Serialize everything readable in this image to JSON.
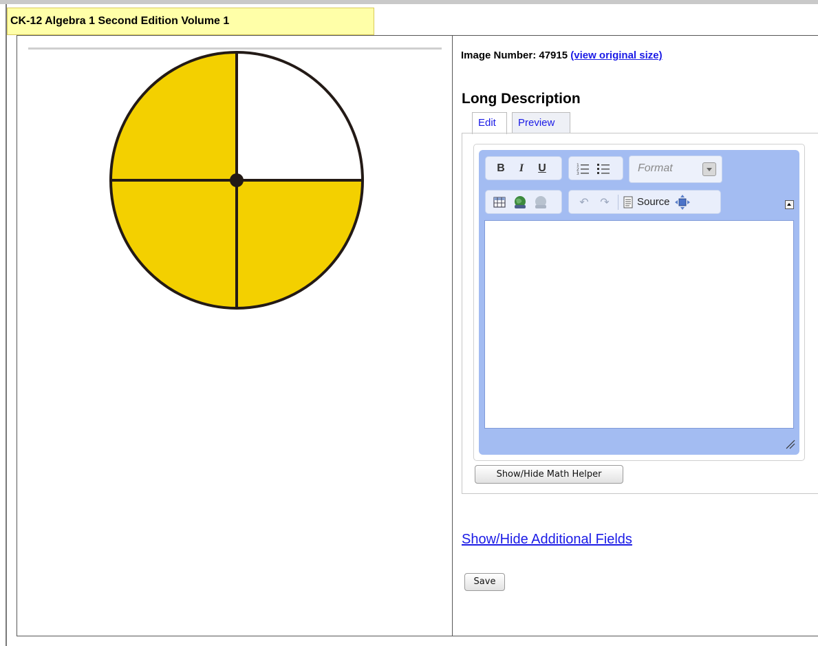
{
  "header": {
    "title": "CK-12 Algebra 1 Second Edition Volume 1"
  },
  "image_info": {
    "label": "Image Number: 47915",
    "view_original_link": "(view original size)"
  },
  "long_description": {
    "heading": "Long Description",
    "tabs": [
      {
        "label": "Edit",
        "active": true
      },
      {
        "label": "Preview",
        "active": false
      }
    ]
  },
  "editor": {
    "toolbar_row1": [
      {
        "name": "bold",
        "label": "B"
      },
      {
        "name": "italic",
        "label": "I"
      },
      {
        "name": "underline",
        "label": "U"
      }
    ],
    "format_placeholder": "Format",
    "source_label": "Source",
    "content": ""
  },
  "buttons": {
    "math_helper": "Show/Hide Math Helper",
    "additional_fields": "Show/Hide Additional Fields",
    "save": "Save"
  },
  "figure": {
    "fill_color": "#f3d000",
    "outline_color": "#231a16",
    "shaded_quarters": [
      "top-left",
      "bottom-left",
      "bottom-right"
    ],
    "unshaded_quarters": [
      "top-right"
    ]
  },
  "colors": {
    "link": "#1a1ae6",
    "editor_chrome": "#a3bcf2",
    "header_tab": "#ffffa8"
  }
}
